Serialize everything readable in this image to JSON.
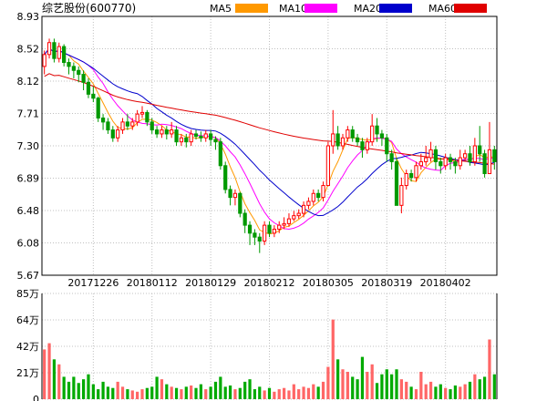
{
  "chart_data": {
    "type": "candlestick",
    "title": "综艺股份(600770)",
    "price_axis": {
      "ticks": [
        "8.93",
        "8.52",
        "8.12",
        "7.71",
        "7.30",
        "6.89",
        "6.48",
        "6.08",
        "5.67"
      ],
      "ylim": [
        5.67,
        8.93
      ]
    },
    "volume_axis": {
      "ticks": [
        "85万",
        "64万",
        "42万",
        "21万",
        "0"
      ],
      "ylim": [
        0,
        85
      ]
    },
    "x_ticks": [
      "20171226",
      "20180112",
      "20180129",
      "20180212",
      "20180305",
      "20180319",
      "20180402"
    ],
    "x_tick_index": [
      10,
      22,
      34,
      46,
      58,
      70,
      82
    ],
    "legend": [
      {
        "name": "MA5",
        "color": "#ff9900"
      },
      {
        "name": "MA10",
        "color": "#ff00ff"
      },
      {
        "name": "MA20",
        "color": "#0000cc"
      },
      {
        "name": "MA60",
        "color": "#e00000"
      }
    ],
    "colors": {
      "up": "#ff0000",
      "down": "#009900",
      "grid": "#c0c0c0",
      "frame": "#000000"
    },
    "candles": [
      [
        8.3,
        8.45,
        8.2,
        8.5
      ],
      [
        8.45,
        8.6,
        8.4,
        8.65
      ],
      [
        8.6,
        8.4,
        8.35,
        8.65
      ],
      [
        8.4,
        8.55,
        8.35,
        8.6
      ],
      [
        8.55,
        8.35,
        8.3,
        8.58
      ],
      [
        8.35,
        8.3,
        8.2,
        8.4
      ],
      [
        8.3,
        8.25,
        8.15,
        8.35
      ],
      [
        8.25,
        8.2,
        8.1,
        8.3
      ],
      [
        8.2,
        8.1,
        8.0,
        8.25
      ],
      [
        8.1,
        7.95,
        7.9,
        8.15
      ],
      [
        7.95,
        7.9,
        7.85,
        8.05
      ],
      [
        7.9,
        7.65,
        7.6,
        7.92
      ],
      [
        7.65,
        7.6,
        7.5,
        7.7
      ],
      [
        7.6,
        7.5,
        7.45,
        7.65
      ],
      [
        7.5,
        7.4,
        7.35,
        7.55
      ],
      [
        7.4,
        7.5,
        7.35,
        7.55
      ],
      [
        7.5,
        7.6,
        7.45,
        7.65
      ],
      [
        7.6,
        7.55,
        7.5,
        7.7
      ],
      [
        7.55,
        7.6,
        7.5,
        7.65
      ],
      [
        7.6,
        7.7,
        7.55,
        7.75
      ],
      [
        7.7,
        7.72,
        7.65,
        7.8
      ],
      [
        7.72,
        7.6,
        7.55,
        7.75
      ],
      [
        7.6,
        7.5,
        7.45,
        7.65
      ],
      [
        7.5,
        7.45,
        7.4,
        7.55
      ],
      [
        7.45,
        7.5,
        7.4,
        7.55
      ],
      [
        7.5,
        7.45,
        7.38,
        7.55
      ],
      [
        7.45,
        7.5,
        7.4,
        7.6
      ],
      [
        7.5,
        7.35,
        7.3,
        7.55
      ],
      [
        7.35,
        7.4,
        7.3,
        7.45
      ],
      [
        7.4,
        7.35,
        7.28,
        7.45
      ],
      [
        7.35,
        7.45,
        7.3,
        7.5
      ],
      [
        7.45,
        7.42,
        7.38,
        7.5
      ],
      [
        7.42,
        7.4,
        7.35,
        7.48
      ],
      [
        7.4,
        7.45,
        7.35,
        7.5
      ],
      [
        7.45,
        7.38,
        7.3,
        7.5
      ],
      [
        7.38,
        7.35,
        7.25,
        7.42
      ],
      [
        7.35,
        7.05,
        7.0,
        7.4
      ],
      [
        7.05,
        6.75,
        6.7,
        7.1
      ],
      [
        6.75,
        6.65,
        6.55,
        6.8
      ],
      [
        6.65,
        6.7,
        6.55,
        6.75
      ],
      [
        6.7,
        6.45,
        6.4,
        6.72
      ],
      [
        6.45,
        6.3,
        6.2,
        6.5
      ],
      [
        6.3,
        6.2,
        6.05,
        6.35
      ],
      [
        6.2,
        6.15,
        6.05,
        6.25
      ],
      [
        6.15,
        6.1,
        5.95,
        6.2
      ],
      [
        6.1,
        6.3,
        6.05,
        6.35
      ],
      [
        6.3,
        6.2,
        6.15,
        6.35
      ],
      [
        6.2,
        6.25,
        6.15,
        6.3
      ],
      [
        6.25,
        6.3,
        6.2,
        6.35
      ],
      [
        6.3,
        6.32,
        6.25,
        6.4
      ],
      [
        6.32,
        6.38,
        6.28,
        6.45
      ],
      [
        6.38,
        6.42,
        6.35,
        6.48
      ],
      [
        6.42,
        6.45,
        6.38,
        6.5
      ],
      [
        6.45,
        6.55,
        6.4,
        6.6
      ],
      [
        6.55,
        6.6,
        6.5,
        6.65
      ],
      [
        6.6,
        6.7,
        6.55,
        6.75
      ],
      [
        6.7,
        6.65,
        6.6,
        6.75
      ],
      [
        6.65,
        6.8,
        6.6,
        6.85
      ],
      [
        6.8,
        7.3,
        6.8,
        7.35
      ],
      [
        7.3,
        7.45,
        7.2,
        7.75
      ],
      [
        7.45,
        7.3,
        7.25,
        7.55
      ],
      [
        7.3,
        7.4,
        7.25,
        7.45
      ],
      [
        7.4,
        7.5,
        7.35,
        7.55
      ],
      [
        7.5,
        7.4,
        7.35,
        7.55
      ],
      [
        7.4,
        7.35,
        7.3,
        7.45
      ],
      [
        7.35,
        7.25,
        7.15,
        7.4
      ],
      [
        7.25,
        7.35,
        7.2,
        7.4
      ],
      [
        7.35,
        7.55,
        7.3,
        7.7
      ],
      [
        7.55,
        7.45,
        7.35,
        7.65
      ],
      [
        7.45,
        7.4,
        7.3,
        7.5
      ],
      [
        7.4,
        7.2,
        7.1,
        7.45
      ],
      [
        7.2,
        7.1,
        7.0,
        7.25
      ],
      [
        7.1,
        6.55,
        6.55,
        7.15
      ],
      [
        6.55,
        6.8,
        6.45,
        6.9
      ],
      [
        6.8,
        6.95,
        6.75,
        7.0
      ],
      [
        6.95,
        6.9,
        6.85,
        7.0
      ],
      [
        6.9,
        7.05,
        6.85,
        7.1
      ],
      [
        7.05,
        7.1,
        7.0,
        7.2
      ],
      [
        7.1,
        7.15,
        7.05,
        7.3
      ],
      [
        7.15,
        7.25,
        7.1,
        7.35
      ],
      [
        7.25,
        7.1,
        7.0,
        7.3
      ],
      [
        7.1,
        7.05,
        6.95,
        7.15
      ],
      [
        7.05,
        7.15,
        7.0,
        7.2
      ],
      [
        7.15,
        7.1,
        7.0,
        7.2
      ],
      [
        7.1,
        7.05,
        6.95,
        7.15
      ],
      [
        7.05,
        7.15,
        7.0,
        7.25
      ],
      [
        7.15,
        7.2,
        7.1,
        7.25
      ],
      [
        7.2,
        7.1,
        7.05,
        7.3
      ],
      [
        7.1,
        7.3,
        7.05,
        7.4
      ],
      [
        7.3,
        7.2,
        7.1,
        7.55
      ],
      [
        7.2,
        6.95,
        6.9,
        7.25
      ],
      [
        6.95,
        7.25,
        6.95,
        7.6
      ],
      [
        7.25,
        7.1,
        7.0,
        7.3
      ]
    ],
    "volumes": [
      40,
      45,
      32,
      28,
      18,
      14,
      18,
      13,
      16,
      20,
      12,
      8,
      14,
      10,
      9,
      14,
      10,
      8,
      7,
      6,
      8,
      9,
      10,
      18,
      16,
      12,
      10,
      9,
      8,
      10,
      11,
      9,
      12,
      8,
      10,
      14,
      18,
      10,
      11,
      8,
      9,
      14,
      16,
      8,
      10,
      7,
      9,
      6,
      8,
      9,
      7,
      12,
      8,
      10,
      9,
      12,
      10,
      14,
      26,
      64,
      32,
      24,
      22,
      18,
      16,
      34,
      22,
      28,
      13,
      20,
      24,
      20,
      24,
      16,
      14,
      10,
      8,
      22,
      12,
      14,
      10,
      12,
      9,
      8,
      11,
      10,
      12,
      14,
      20,
      16,
      18,
      48,
      20
    ]
  }
}
